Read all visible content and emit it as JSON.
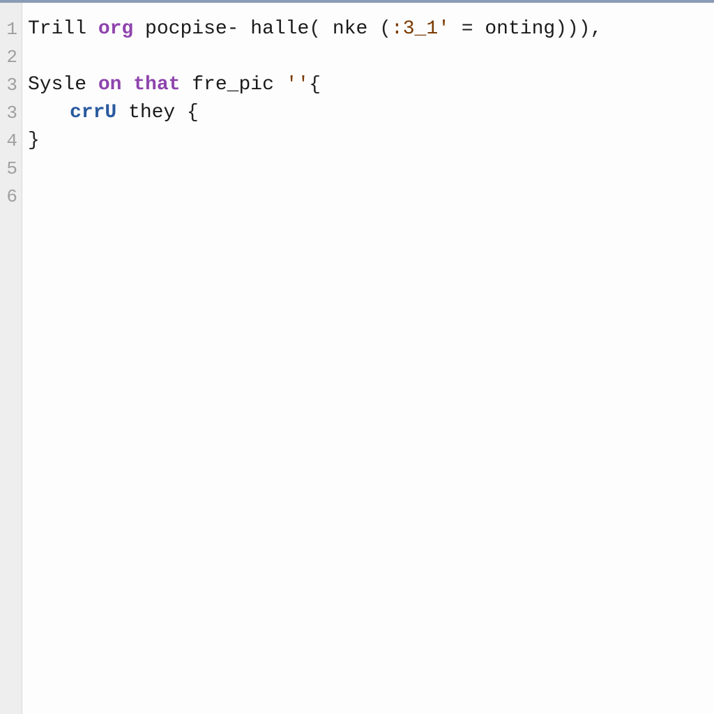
{
  "gutter": {
    "numbers": [
      "1",
      "2",
      "3",
      "3",
      "4",
      "5",
      "6"
    ]
  },
  "code": {
    "line1": {
      "t1": "Trill ",
      "kw1": "org",
      "t2": " pocpise- halle",
      "p1": "(",
      "t3": " nke ",
      "p2": "(",
      "str1": ":3_1'",
      "t4": " = onting",
      "p3": ")))",
      "p4": ","
    },
    "line3": {
      "t1": "Sysle ",
      "kw1": "on that",
      "t2": " fre_pic ",
      "str1": "''",
      "p1": "{"
    },
    "line4": {
      "kw1": "crrU",
      "t1": " they ",
      "p1": "{"
    },
    "line5": {
      "p1": "}"
    }
  }
}
